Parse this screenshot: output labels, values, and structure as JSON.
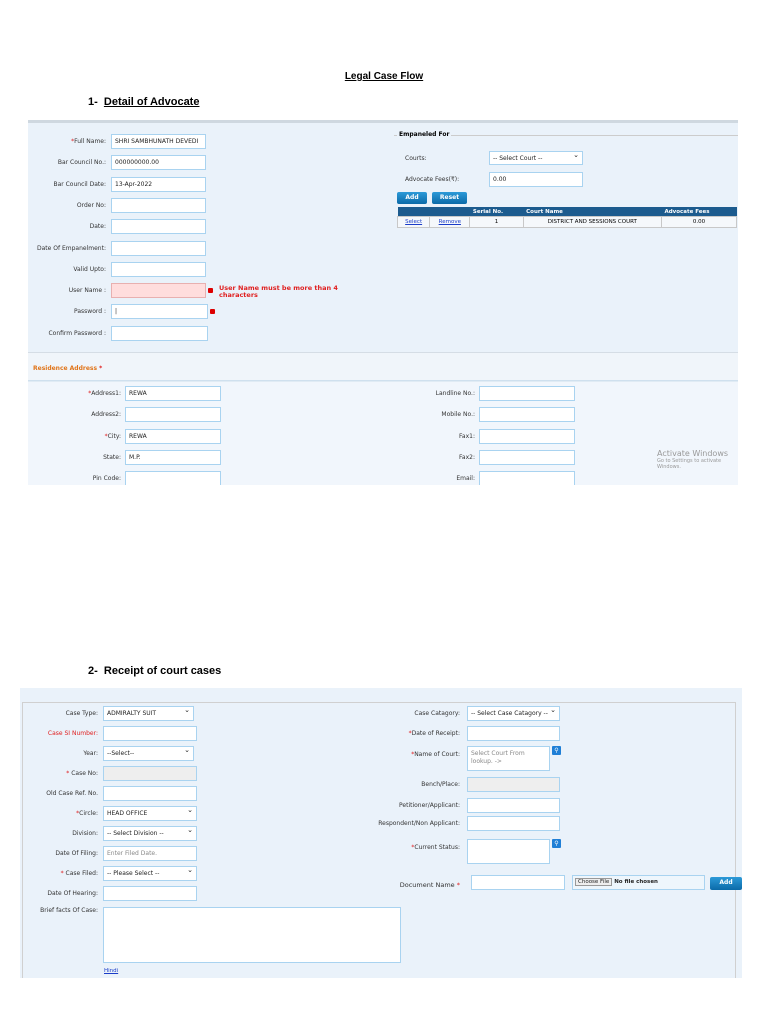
{
  "title": "Legal Case Flow",
  "section1": {
    "num": "1-",
    "heading": "Detail of Advocate"
  },
  "section2": {
    "num": "2-",
    "heading": "Receipt of court cases"
  },
  "advocate": {
    "fields": [
      {
        "label": "Full Name:",
        "req": "*",
        "value": "SHRI SAMBHUNATH DEVEDI"
      },
      {
        "label": "Bar Council No.:",
        "value": "000000000.00"
      },
      {
        "label": "Bar Council Date:",
        "value": "13-Apr-2022"
      },
      {
        "label": "Order No:",
        "value": ""
      },
      {
        "label": "Date:",
        "value": ""
      },
      {
        "label": "Date Of Empanelment:",
        "value": ""
      },
      {
        "label": "Valid Upto:",
        "value": ""
      },
      {
        "label": "User Name :",
        "value": "",
        "error": true
      },
      {
        "label": "Password :",
        "value": "|",
        "error_icon": true
      },
      {
        "label": "Confirm Password :",
        "value": ""
      }
    ],
    "username_error": "User Name must be more than 4 characters",
    "empaneled": {
      "legend": "Empaneled For",
      "courts_label": "Courts:",
      "courts_value": "-- Select Court --",
      "fees_label": "Advocate Fees(₹):",
      "fees_value": "0.00",
      "add": "Add",
      "reset": "Reset",
      "columns": [
        "",
        "",
        "Serial No.",
        "Court Name",
        "Advocate Fees"
      ],
      "rows": [
        {
          "select": "Select",
          "remove": "Remove",
          "serial": "1",
          "court": "DISTRICT AND SESSIONS COURT",
          "fees": "0.00"
        }
      ]
    },
    "residence": {
      "heading": "Residence Address",
      "req": "*",
      "left": [
        {
          "label": "Address1:",
          "req": "*",
          "value": "REWA"
        },
        {
          "label": "Address2:",
          "value": ""
        },
        {
          "label": "City:",
          "req": "*",
          "value": "REWA"
        },
        {
          "label": "State:",
          "value": "M.P."
        },
        {
          "label": "Pin Code:",
          "value": ""
        }
      ],
      "right": [
        {
          "label": "Landline No.:",
          "value": ""
        },
        {
          "label": "Mobile No.:",
          "value": ""
        },
        {
          "label": "Fax1:",
          "value": ""
        },
        {
          "label": "Fax2:",
          "value": ""
        },
        {
          "label": "Email:",
          "value": ""
        }
      ]
    },
    "watermark": {
      "line1": "Activate Windows",
      "line2": "Go to Settings to activate Windows."
    }
  },
  "receipt": {
    "left": [
      {
        "label": "Case Type:",
        "value": "ADMIRALTY SUIT",
        "type": "select"
      },
      {
        "label": "Case SI Number:",
        "value": "",
        "red": true
      },
      {
        "label": "Year:",
        "value": "--Select--",
        "type": "select"
      },
      {
        "label": "Case No:",
        "req": "* ",
        "value": "",
        "type": "disabled"
      },
      {
        "label": "Old Case Ref. No.",
        "value": ""
      },
      {
        "label": "Circle:",
        "req": "*",
        "value": "HEAD OFFICE",
        "type": "select"
      },
      {
        "label": "Division:",
        "value": "-- Select Division --",
        "type": "select"
      },
      {
        "label": "Date Of Filing:",
        "value": "Enter Filed Date.",
        "type": "placeholder"
      },
      {
        "label": "Case Filed:",
        "req": "* ",
        "value": "-- Please Select --",
        "type": "select"
      },
      {
        "label": "Date Of Hearing:",
        "value": ""
      }
    ],
    "brief_label": "Brief facts Of Case:",
    "hindi_link": "Hindi",
    "right": [
      {
        "label": "Case Catagory:",
        "value": "-- Select Case Catagory --",
        "type": "select"
      },
      {
        "label": "Date of Receipt:",
        "req": "*",
        "value": ""
      },
      {
        "label": "Name of Court:",
        "req": "*",
        "value": "Select Court From lookup. ->",
        "type": "lookup"
      },
      {
        "label": "Bench/Place:",
        "value": "",
        "type": "disabled"
      },
      {
        "label": "Petitioner/Applicant:",
        "value": ""
      },
      {
        "label": "Respondent/Non Applicant:",
        "value": ""
      },
      {
        "label": "Current Status:",
        "req": "*",
        "value": "",
        "type": "lookup"
      }
    ],
    "document_label": "Document Name",
    "document_req": "*",
    "choose_file": "Choose File",
    "no_file": "No file chosen",
    "add": "Add"
  }
}
